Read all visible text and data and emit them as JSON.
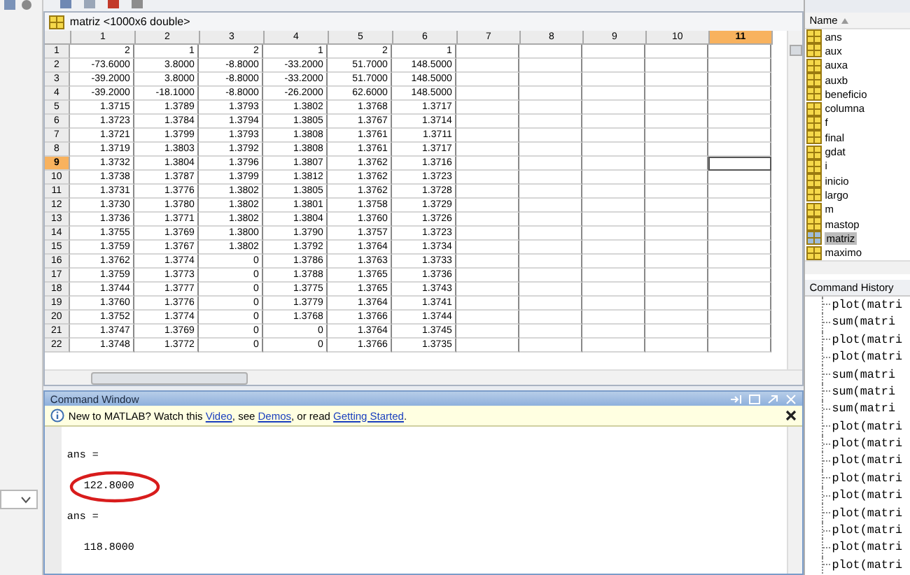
{
  "variable_editor": {
    "title": "matriz <1000x6 double>",
    "columns": [
      {
        "label": "1",
        "selected": false
      },
      {
        "label": "2",
        "selected": false
      },
      {
        "label": "3",
        "selected": false
      },
      {
        "label": "4",
        "selected": false
      },
      {
        "label": "5",
        "selected": false
      },
      {
        "label": "6",
        "selected": false
      },
      {
        "label": "7",
        "selected": false
      },
      {
        "label": "8",
        "selected": false
      },
      {
        "label": "9",
        "selected": false
      },
      {
        "label": "10",
        "selected": false
      },
      {
        "label": "11",
        "selected": true
      }
    ],
    "rows": [
      {
        "label": "1",
        "selected": false,
        "cells": [
          "2",
          "1",
          "2",
          "1",
          "2",
          "1"
        ]
      },
      {
        "label": "2",
        "selected": false,
        "cells": [
          "-73.6000",
          "3.8000",
          "-8.8000",
          "-33.2000",
          "51.7000",
          "148.5000"
        ]
      },
      {
        "label": "3",
        "selected": false,
        "cells": [
          "-39.2000",
          "3.8000",
          "-8.8000",
          "-33.2000",
          "51.7000",
          "148.5000"
        ]
      },
      {
        "label": "4",
        "selected": false,
        "cells": [
          "-39.2000",
          "-18.1000",
          "-8.8000",
          "-26.2000",
          "62.6000",
          "148.5000"
        ]
      },
      {
        "label": "5",
        "selected": false,
        "cells": [
          "1.3715",
          "1.3789",
          "1.3793",
          "1.3802",
          "1.3768",
          "1.3717"
        ]
      },
      {
        "label": "6",
        "selected": false,
        "cells": [
          "1.3723",
          "1.3784",
          "1.3794",
          "1.3805",
          "1.3767",
          "1.3714"
        ]
      },
      {
        "label": "7",
        "selected": false,
        "cells": [
          "1.3721",
          "1.3799",
          "1.3793",
          "1.3808",
          "1.3761",
          "1.3711"
        ]
      },
      {
        "label": "8",
        "selected": false,
        "cells": [
          "1.3719",
          "1.3803",
          "1.3792",
          "1.3808",
          "1.3761",
          "1.3717"
        ]
      },
      {
        "label": "9",
        "selected": true,
        "cells": [
          "1.3732",
          "1.3804",
          "1.3796",
          "1.3807",
          "1.3762",
          "1.3716"
        ]
      },
      {
        "label": "10",
        "selected": false,
        "cells": [
          "1.3738",
          "1.3787",
          "1.3799",
          "1.3812",
          "1.3762",
          "1.3723"
        ]
      },
      {
        "label": "11",
        "selected": false,
        "cells": [
          "1.3731",
          "1.3776",
          "1.3802",
          "1.3805",
          "1.3762",
          "1.3728"
        ]
      },
      {
        "label": "12",
        "selected": false,
        "cells": [
          "1.3730",
          "1.3780",
          "1.3802",
          "1.3801",
          "1.3758",
          "1.3729"
        ]
      },
      {
        "label": "13",
        "selected": false,
        "cells": [
          "1.3736",
          "1.3771",
          "1.3802",
          "1.3804",
          "1.3760",
          "1.3726"
        ]
      },
      {
        "label": "14",
        "selected": false,
        "cells": [
          "1.3755",
          "1.3769",
          "1.3800",
          "1.3790",
          "1.3757",
          "1.3723"
        ]
      },
      {
        "label": "15",
        "selected": false,
        "cells": [
          "1.3759",
          "1.3767",
          "1.3802",
          "1.3792",
          "1.3764",
          "1.3734"
        ]
      },
      {
        "label": "16",
        "selected": false,
        "cells": [
          "1.3762",
          "1.3774",
          "0",
          "1.3786",
          "1.3763",
          "1.3733"
        ]
      },
      {
        "label": "17",
        "selected": false,
        "cells": [
          "1.3759",
          "1.3773",
          "0",
          "1.3788",
          "1.3765",
          "1.3736"
        ]
      },
      {
        "label": "18",
        "selected": false,
        "cells": [
          "1.3744",
          "1.3777",
          "0",
          "1.3775",
          "1.3765",
          "1.3743"
        ]
      },
      {
        "label": "19",
        "selected": false,
        "cells": [
          "1.3760",
          "1.3776",
          "0",
          "1.3779",
          "1.3764",
          "1.3741"
        ]
      },
      {
        "label": "20",
        "selected": false,
        "cells": [
          "1.3752",
          "1.3774",
          "0",
          "1.3768",
          "1.3766",
          "1.3744"
        ]
      },
      {
        "label": "21",
        "selected": false,
        "cells": [
          "1.3747",
          "1.3769",
          "0",
          "0",
          "1.3764",
          "1.3745"
        ]
      },
      {
        "label": "22",
        "selected": false,
        "cells": [
          "1.3748",
          "1.3772",
          "0",
          "0",
          "1.3766",
          "1.3735"
        ]
      }
    ]
  },
  "command_window": {
    "title": "Command Window",
    "notice": [
      {
        "kind": "text",
        "text": "New to MATLAB? Watch this "
      },
      {
        "kind": "link",
        "text": "Video"
      },
      {
        "kind": "text",
        "text": ", see "
      },
      {
        "kind": "link",
        "text": "Demos"
      },
      {
        "kind": "text",
        "text": ", or read "
      },
      {
        "kind": "link",
        "text": "Getting Started"
      },
      {
        "kind": "text",
        "text": "."
      }
    ],
    "lines": [
      {
        "kind": "label",
        "text": "ans =",
        "highlighted": false
      },
      {
        "kind": "value",
        "text": "122.8000",
        "highlighted": true
      },
      {
        "kind": "label",
        "text": "ans =",
        "highlighted": false
      },
      {
        "kind": "value",
        "text": "118.8000",
        "highlighted": false
      }
    ]
  },
  "workspace": {
    "column": "Name",
    "items": [
      {
        "name": "ans",
        "selected": false
      },
      {
        "name": "aux",
        "selected": false
      },
      {
        "name": "auxa",
        "selected": false
      },
      {
        "name": "auxb",
        "selected": false
      },
      {
        "name": "beneficio",
        "selected": false
      },
      {
        "name": "columna",
        "selected": false
      },
      {
        "name": "f",
        "selected": false
      },
      {
        "name": "final",
        "selected": false
      },
      {
        "name": "gdat",
        "selected": false
      },
      {
        "name": "i",
        "selected": false
      },
      {
        "name": "inicio",
        "selected": false
      },
      {
        "name": "largo",
        "selected": false
      },
      {
        "name": "m",
        "selected": false
      },
      {
        "name": "mastop",
        "selected": false
      },
      {
        "name": "matriz",
        "selected": true
      },
      {
        "name": "maximo",
        "selected": false
      }
    ]
  },
  "command_history": {
    "title": "Command History",
    "entries": [
      "plot(matri",
      "sum(matri",
      "plot(matri",
      "plot(matri",
      "sum(matri",
      "sum(matri",
      "sum(matri",
      "plot(matri",
      "plot(matri",
      "plot(matri",
      "plot(matri",
      "plot(matri",
      "plot(matri",
      "plot(matri",
      "plot(matri",
      "plot(matri"
    ]
  }
}
